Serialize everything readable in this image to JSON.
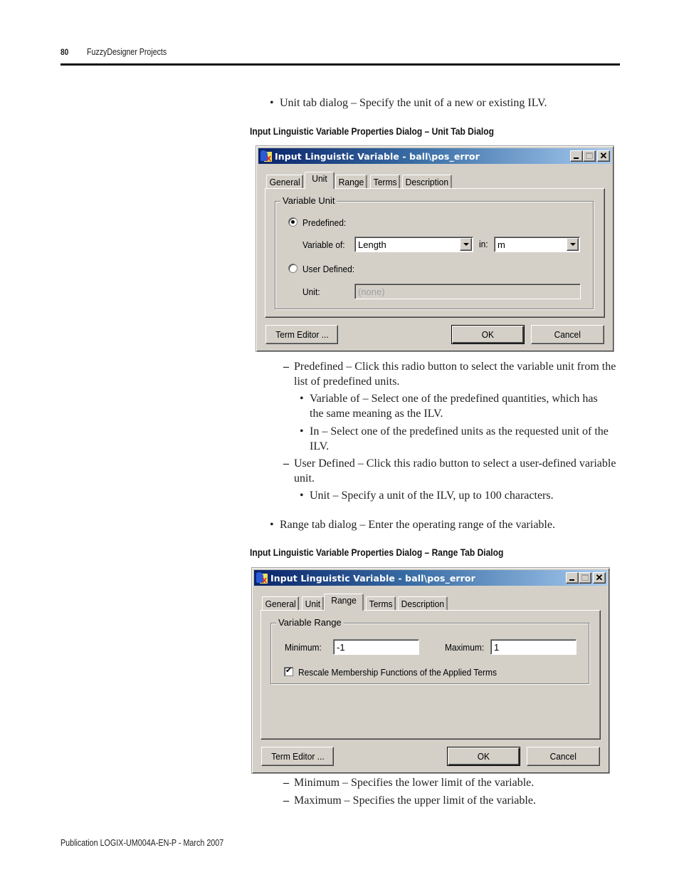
{
  "header": {
    "page_number": "80",
    "section_title": "FuzzyDesigner Projects"
  },
  "content": {
    "intro_unit": "Unit tab dialog – Specify the unit of a new or existing ILV.",
    "caption_unit": "Input Linguistic Variable Properties Dialog – Unit Tab Dialog",
    "unit_notes": {
      "predefined": "Predefined – Click this radio button to select the variable unit from the list of predefined units.",
      "variable_of": "Variable of – Select one of the predefined quantities, which has the same meaning as the ILV.",
      "in": "In – Select one of the predefined units as the requested unit of the ILV.",
      "user_defined": "User Defined – Click this radio button to select a user-defined variable unit.",
      "unit": "Unit – Specify a unit of the ILV, up to 100 characters."
    },
    "intro_range": "Range tab dialog – Enter the operating range of the variable.",
    "caption_range": "Input Linguistic Variable Properties Dialog – Range Tab Dialog",
    "range_notes": {
      "minimum": "Minimum – Specifies the lower limit of the variable.",
      "maximum": "Maximum – Specifies the upper limit of the variable."
    }
  },
  "unit_dialog": {
    "title": "Input Linguistic Variable - ball\\pos_error",
    "tabs": [
      "General",
      "Unit",
      "Range",
      "Terms",
      "Description"
    ],
    "active_tab": "Unit",
    "group_label": "Variable Unit",
    "predefined_label": "Predefined:",
    "predefined_selected": true,
    "variable_of_label": "Variable of:",
    "variable_of_value": "Length",
    "in_label": "in:",
    "in_value": "m",
    "user_defined_label": "User Defined:",
    "user_defined_selected": false,
    "unit_label": "Unit:",
    "unit_value": "(none)",
    "buttons": {
      "term_editor": "Term Editor ...",
      "ok": "OK",
      "cancel": "Cancel"
    }
  },
  "range_dialog": {
    "title": "Input Linguistic Variable - ball\\pos_error",
    "tabs": [
      "General",
      "Unit",
      "Range",
      "Terms",
      "Description"
    ],
    "active_tab": "Range",
    "group_label": "Variable Range",
    "minimum_label": "Minimum:",
    "minimum_value": "-1",
    "maximum_label": "Maximum:",
    "maximum_value": "1",
    "rescale_label": "Rescale Membership Functions of the Applied Terms",
    "rescale_checked": true,
    "buttons": {
      "term_editor": "Term Editor ...",
      "ok": "OK",
      "cancel": "Cancel"
    }
  },
  "footer": {
    "publication": "Publication LOGIX-UM004A-EN-P - March 2007"
  }
}
